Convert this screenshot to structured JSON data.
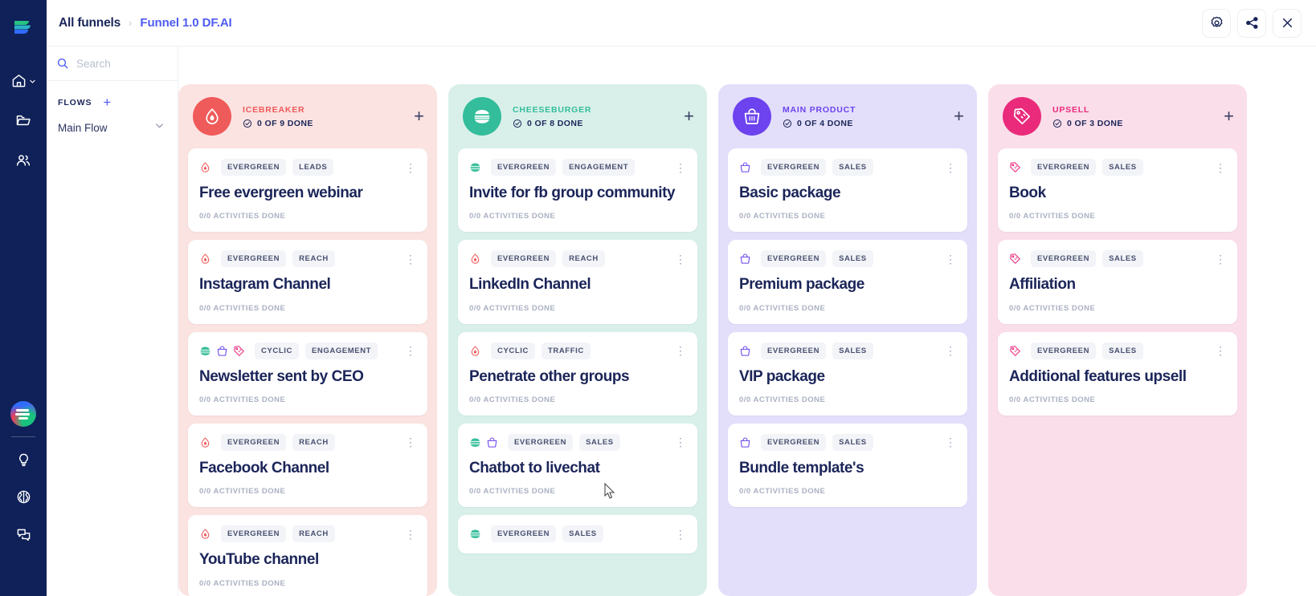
{
  "header": {
    "breadcrumb_root": "All funnels",
    "breadcrumb_separator": "›",
    "breadcrumb_current": "Funnel 1.0 DF.AI",
    "actions": [
      {
        "name": "settings-button",
        "icon": "gear-icon"
      },
      {
        "name": "share-button",
        "icon": "share-icon"
      },
      {
        "name": "close-button",
        "icon": "close-icon"
      }
    ]
  },
  "rail": {
    "logo": "app-logo",
    "top_items": [
      {
        "name": "home",
        "icon": "home-icon",
        "has_chevron": true
      },
      {
        "name": "projects",
        "icon": "folder-icon",
        "has_chevron": false
      },
      {
        "name": "team",
        "icon": "people-icon",
        "has_chevron": false
      }
    ],
    "avatar": "user-avatar",
    "bottom_items": [
      {
        "name": "ideas",
        "icon": "lightbulb-icon"
      },
      {
        "name": "knowledge",
        "icon": "brain-icon"
      },
      {
        "name": "chat",
        "icon": "chat-icon"
      }
    ]
  },
  "panel": {
    "search_placeholder": "Search",
    "search_value": "",
    "flows_label": "FLOWS",
    "add_flow_label": "+",
    "flow_name": "Main Flow"
  },
  "colors": {
    "icebreaker": "#ef5a5a",
    "icebreaker_bg": "#fbe3e1",
    "cheeseburger": "#33bd9a",
    "cheeseburger_bg": "#d9f0ea",
    "main_product": "#6c43ee",
    "main_product_bg": "#e3dffa",
    "upsell": "#ea2a7b",
    "upsell_bg": "#fadeea",
    "accent": "#4e5cf0",
    "text_dark": "#1b2559"
  },
  "board": {
    "add_card_label": "+",
    "kebab_label": "⋮",
    "columns": [
      {
        "id": "icebreaker",
        "title": "ICEBREAKER",
        "done_text": "0 OF 9 DONE",
        "icon": "flame-icon",
        "cards": [
          {
            "icons": [
              "flame-icon"
            ],
            "tags": [
              "EVERGREEN",
              "LEADS"
            ],
            "title": "Free evergreen webinar",
            "sub": "0/0 ACTIVITIES DONE"
          },
          {
            "icons": [
              "flame-icon"
            ],
            "tags": [
              "EVERGREEN",
              "REACH"
            ],
            "title": "Instagram Channel",
            "sub": "0/0 ACTIVITIES DONE"
          },
          {
            "icons": [
              "burger-icon",
              "basket-icon",
              "tag-icon"
            ],
            "tags": [
              "CYCLIC",
              "ENGAGEMENT"
            ],
            "title": "Newsletter sent by CEO",
            "sub": "0/0 ACTIVITIES DONE"
          },
          {
            "icons": [
              "flame-icon"
            ],
            "tags": [
              "EVERGREEN",
              "REACH"
            ],
            "title": "Facebook Channel",
            "sub": "0/0 ACTIVITIES DONE"
          },
          {
            "icons": [
              "flame-icon"
            ],
            "tags": [
              "EVERGREEN",
              "REACH"
            ],
            "title": "YouTube channel",
            "sub": "0/0 ACTIVITIES DONE"
          }
        ]
      },
      {
        "id": "cheeseburger",
        "title": "CHEESEBURGER",
        "done_text": "0 OF 8 DONE",
        "icon": "burger-icon",
        "cards": [
          {
            "icons": [
              "burger-icon"
            ],
            "tags": [
              "EVERGREEN",
              "ENGAGEMENT"
            ],
            "title": "Invite for fb group community",
            "sub": "0/0 ACTIVITIES DONE"
          },
          {
            "icons": [
              "flame-icon"
            ],
            "tags": [
              "EVERGREEN",
              "REACH"
            ],
            "title": "LinkedIn Channel",
            "sub": "0/0 ACTIVITIES DONE"
          },
          {
            "icons": [
              "flame-icon"
            ],
            "tags": [
              "CYCLIC",
              "TRAFFIC"
            ],
            "title": "Penetrate other groups",
            "sub": "0/0 ACTIVITIES DONE"
          },
          {
            "icons": [
              "burger-icon",
              "basket-icon"
            ],
            "tags": [
              "EVERGREEN",
              "SALES"
            ],
            "title": "Chatbot to livechat",
            "sub": "0/0 ACTIVITIES DONE"
          },
          {
            "icons": [
              "burger-icon"
            ],
            "tags": [
              "EVERGREEN",
              "SALES"
            ],
            "title": "",
            "sub": ""
          }
        ]
      },
      {
        "id": "main_product",
        "title": "MAIN PRODUCT",
        "done_text": "0 OF 4 DONE",
        "icon": "basket-icon",
        "cards": [
          {
            "icons": [
              "basket-icon"
            ],
            "tags": [
              "EVERGREEN",
              "SALES"
            ],
            "title": "Basic package",
            "sub": "0/0 ACTIVITIES DONE"
          },
          {
            "icons": [
              "basket-icon"
            ],
            "tags": [
              "EVERGREEN",
              "SALES"
            ],
            "title": "Premium package",
            "sub": "0/0 ACTIVITIES DONE"
          },
          {
            "icons": [
              "basket-icon"
            ],
            "tags": [
              "EVERGREEN",
              "SALES"
            ],
            "title": "VIP package",
            "sub": "0/0 ACTIVITIES DONE"
          },
          {
            "icons": [
              "basket-icon"
            ],
            "tags": [
              "EVERGREEN",
              "SALES"
            ],
            "title": "Bundle template's",
            "sub": "0/0 ACTIVITIES DONE"
          }
        ]
      },
      {
        "id": "upsell",
        "title": "UPSELL",
        "done_text": "0 OF 3 DONE",
        "icon": "tag-icon",
        "cards": [
          {
            "icons": [
              "tag-icon"
            ],
            "tags": [
              "EVERGREEN",
              "SALES"
            ],
            "title": "Book",
            "sub": "0/0 ACTIVITIES DONE"
          },
          {
            "icons": [
              "tag-icon"
            ],
            "tags": [
              "EVERGREEN",
              "SALES"
            ],
            "title": "Affiliation",
            "sub": "0/0 ACTIVITIES DONE"
          },
          {
            "icons": [
              "tag-icon"
            ],
            "tags": [
              "EVERGREEN",
              "SALES"
            ],
            "title": "Additional features upsell",
            "sub": "0/0 ACTIVITIES DONE"
          }
        ]
      }
    ]
  }
}
